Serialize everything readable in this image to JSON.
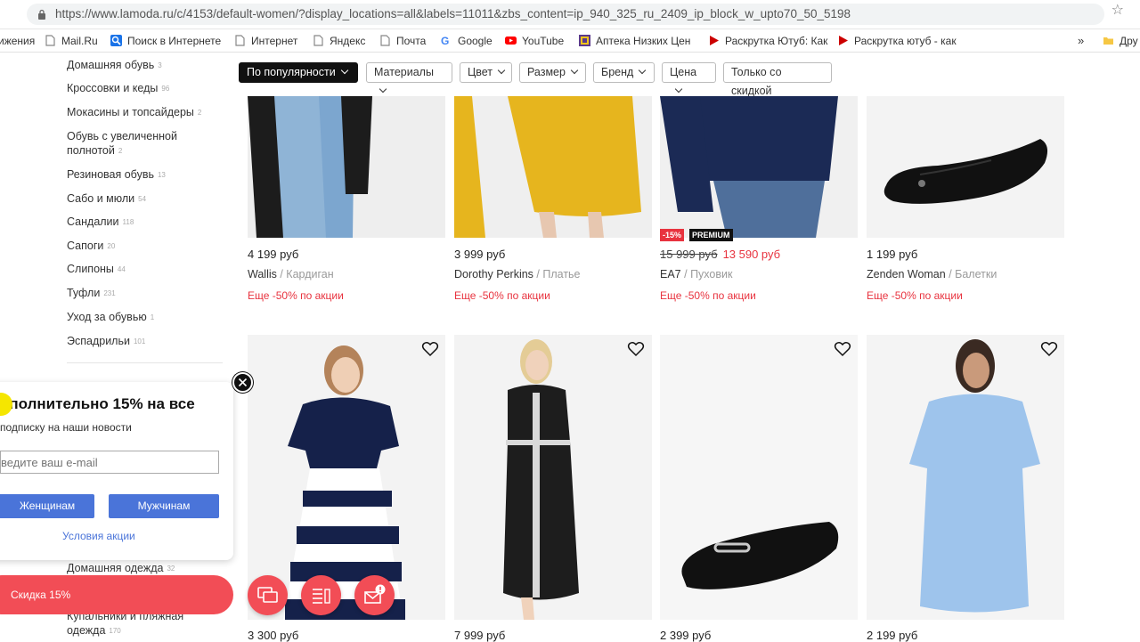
{
  "browser": {
    "url": "https://www.lamoda.ru/c/4153/default-women/?display_locations=all&labels=11011&zbs_content=ip_940_325_ru_2409_ip_block_w_upto70_50_5198",
    "bookmarks": [
      {
        "label": "ижения",
        "icon": "none",
        "color": "#333333"
      },
      {
        "label": "Mail.Ru",
        "icon": "page-icon",
        "color": "#888888"
      },
      {
        "label": "Поиск в Интернете",
        "icon": "search-icon",
        "color": "#1a73e8"
      },
      {
        "label": "Интернет",
        "icon": "page-icon",
        "color": "#888888"
      },
      {
        "label": "Яндекс",
        "icon": "page-icon",
        "color": "#888888"
      },
      {
        "label": "Почта",
        "icon": "page-icon",
        "color": "#888888"
      },
      {
        "label": "Google",
        "icon": "google-icon",
        "color": "#4285f4"
      },
      {
        "label": "YouTube",
        "icon": "youtube-icon",
        "color": "#ff0000"
      },
      {
        "label": "Аптека Низких Цен",
        "icon": "pharmacy-icon",
        "color": "#5b3a8c"
      },
      {
        "label": "Раскрутка Ютуб: Как",
        "icon": "play-icon",
        "color": "#cc0000"
      },
      {
        "label": "Раскрутка ютуб - как",
        "icon": "play-icon",
        "color": "#cc0000"
      }
    ],
    "overflow_label": "»",
    "other_label": "Дру"
  },
  "sidebar": {
    "categories": [
      {
        "label": "Домашняя обувь",
        "count": "3"
      },
      {
        "label": "Кроссовки и кеды",
        "count": "96"
      },
      {
        "label": "Мокасины и топсайдеры",
        "count": "2"
      },
      {
        "label": "Обувь с увеличенной",
        "label2": "полнотой",
        "count": "2"
      },
      {
        "label": "Резиновая обувь",
        "count": "13"
      },
      {
        "label": "Сабо и мюли",
        "count": "54"
      },
      {
        "label": "Сандалии",
        "count": "118"
      },
      {
        "label": "Сапоги",
        "count": "20"
      },
      {
        "label": "Слипоны",
        "count": "44"
      },
      {
        "label": "Туфли",
        "count": "231"
      },
      {
        "label": "Уход за обувью",
        "count": "1"
      },
      {
        "label": "Эспадрильи",
        "count": "101"
      }
    ],
    "bottom_items": [
      {
        "label": "Домашняя одежда",
        "count": "32"
      },
      {
        "label": "Купальники и пляжная",
        "label2": "одежда",
        "count": "170"
      }
    ]
  },
  "filters": [
    {
      "label": "По популярности",
      "active": true
    },
    {
      "label": "Материалы",
      "active": false
    },
    {
      "label": "Цвет",
      "active": false
    },
    {
      "label": "Размер",
      "active": false
    },
    {
      "label": "Бренд",
      "active": false
    },
    {
      "label": "Цена",
      "active": false
    },
    {
      "label": "Только со скидкой",
      "active": false
    }
  ],
  "products_top": [
    {
      "price": "4 199 руб",
      "brand": "Wallis",
      "type": "Кардиган",
      "promo": "Еще -50% по акции"
    },
    {
      "price": "3 999 руб",
      "brand": "Dorothy Perkins",
      "type": "Платье",
      "promo": "Еще -50% по акции"
    },
    {
      "old_price": "15 999 руб",
      "price": "13 590 руб",
      "brand": "EA7",
      "type": "Пуховик",
      "promo": "Еще -50% по акции",
      "discount_badge": "-15%",
      "premium_badge": "PREMIUM"
    },
    {
      "price": "1 199 руб",
      "brand": "Zenden Woman",
      "type": "Балетки",
      "promo": "Еще -50% по акции"
    }
  ],
  "products_bottom": [
    {
      "price": "3 300 руб"
    },
    {
      "price": "7 999 руб"
    },
    {
      "price": "2 399 руб"
    },
    {
      "price": "2 199 руб"
    }
  ],
  "popup": {
    "title": "ополнительно 15% на все",
    "subtitle": "подписку на наши новости",
    "email_placeholder": "ведите ваш e-mail",
    "women_button": "Женщинам",
    "men_button": "Мужчинам",
    "terms_link": "Условия акции"
  },
  "discount_bar": {
    "label": "Скидка 15%"
  },
  "colors": {
    "accent_red": "#f24d56",
    "promo_red": "#e8333f",
    "button_blue": "#4a74d9"
  }
}
